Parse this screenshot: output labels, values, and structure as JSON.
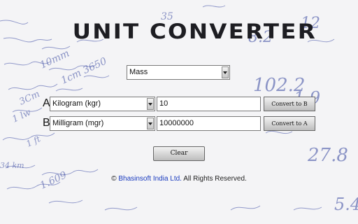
{
  "app": {
    "title": "UNIT CONVERTER"
  },
  "category": {
    "selected": "Mass"
  },
  "row_a": {
    "label": "A",
    "unit": "Kilogram (kgr)",
    "value": "10",
    "convert_label": "Convert to B"
  },
  "row_b": {
    "label": "B",
    "unit": "Milligram (mgr)",
    "value": "10000000",
    "convert_label": "Convert to A"
  },
  "clear_label": "Clear",
  "footer": {
    "symbol": "©",
    "company": "Bhasinsoft India Ltd.",
    "rights": "All Rights Reserved."
  },
  "colors": {
    "link": "#1a3bbf",
    "handwriting": "#35459e"
  }
}
